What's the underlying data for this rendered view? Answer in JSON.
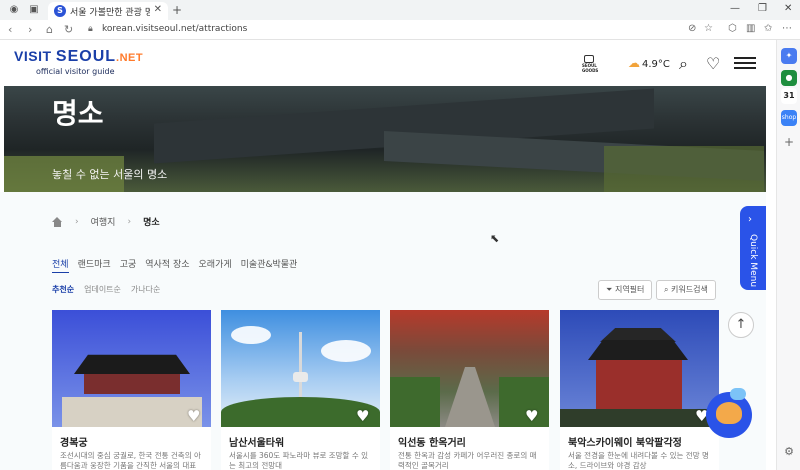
{
  "browser": {
    "tab_title": "서울 가볼만한 관광 명소 |",
    "url": "korean.visitseoul.net/attractions",
    "side_badge": "31",
    "side_shop": "shop"
  },
  "header": {
    "logo_visit": "VISIT",
    "logo_seoul": "SEOUL",
    "logo_net": ".NET",
    "logo_sub": "official visitor guide",
    "goods_label": "SEOUL GOODS",
    "temperature": "4.9°C"
  },
  "hero": {
    "title": "명소",
    "subtitle": "놓칠 수 없는 서울의 명소"
  },
  "breadcrumb": {
    "level1": "여행지",
    "level2": "명소"
  },
  "category_tabs": [
    "전체",
    "랜드마크",
    "고궁",
    "역사적 장소",
    "오래가게",
    "미술관&박물관"
  ],
  "sort_tabs": [
    "추천순",
    "업데이트순",
    "가나다순"
  ],
  "filters": {
    "region": "지역필터",
    "keyword": "키워드검색"
  },
  "cards": [
    {
      "title": "경복궁",
      "desc": "조선시대의 중심 궁궐로, 한국 전통 건축의 아름다움과 웅장한 기품을 간직한 서울의 대표"
    },
    {
      "title": "남산서울타워",
      "desc": "서울시를 360도 파노라마 뷰로 조망할 수 있는 최고의 전망대"
    },
    {
      "title": "익선동 한옥거리",
      "desc": "전통 한옥과 감성 카페가 어우러진 종로의 매력적인 골목거리"
    },
    {
      "title": "북악스카이웨이 북악팔각정",
      "desc": "서울 전경을 한눈에 내려다볼 수 있는 전망 명소, 드라이브와 야경 감상"
    }
  ],
  "quick_menu": "Quick Menu"
}
